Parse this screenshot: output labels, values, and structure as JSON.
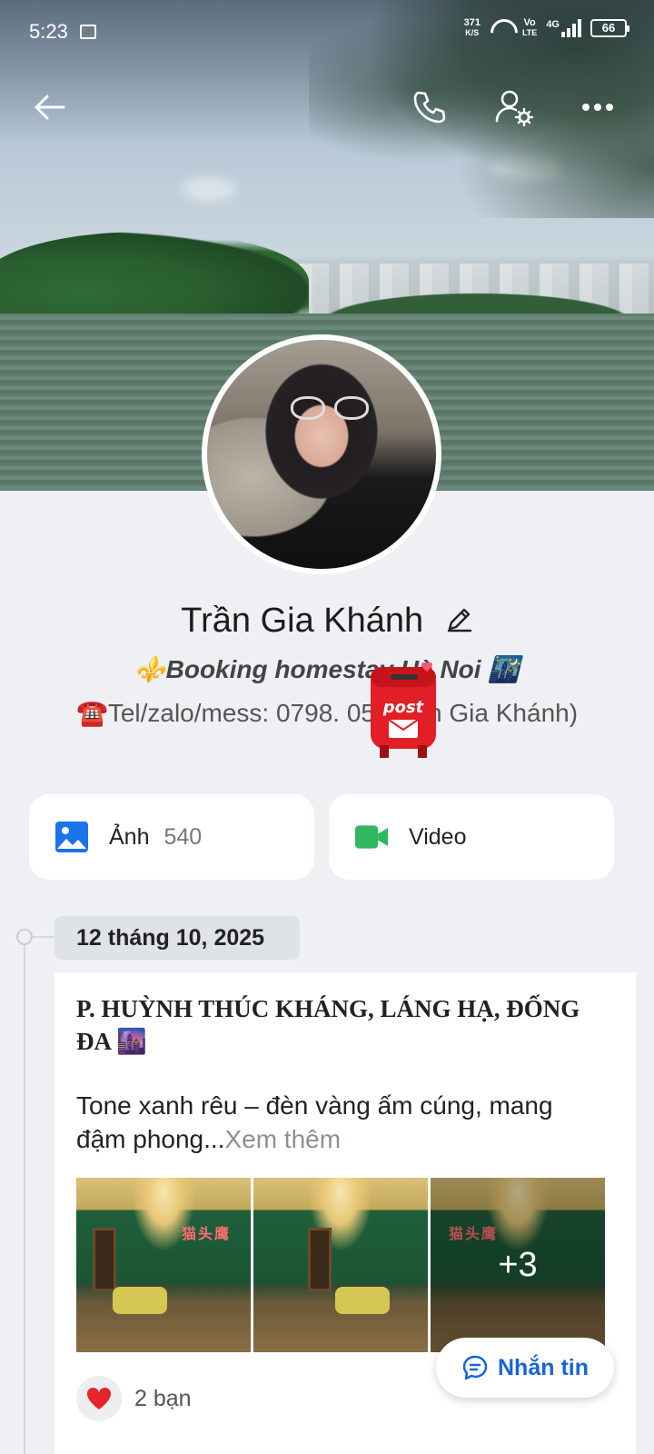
{
  "status_bar": {
    "time": "5:23",
    "net_speed_value": "371",
    "net_speed_unit": "K/S",
    "volte_top": "Vo",
    "volte_bottom": "LTE",
    "network": "4G",
    "battery": "66"
  },
  "profile": {
    "name": "Trần Gia Khánh",
    "bio_line1": "⚜️Booking homestay Hà Noi 🌃",
    "bio_line2": "☎️Tel/zalo/mess: 0798.   05 (Trần Gia Khánh)"
  },
  "media": {
    "photos_label": "Ảnh",
    "photos_count": "540",
    "video_label": "Video"
  },
  "feed": {
    "date": "12 tháng 10, 2025",
    "post": {
      "title": "P. HUỲNH THÚC KHÁNG, LÁNG HẠ, ĐỐNG ĐA 🌆",
      "text": "Tone xanh rêu – đèn vàng ấm cúng, mang đậm phong...",
      "see_more": "Xem thêm",
      "extra_photos": "+3",
      "neon_sign": "猫头鹰",
      "reactions": "2 bạn"
    }
  },
  "actions": {
    "message_label": "Nhắn tin"
  },
  "sticker_text": "post",
  "colors": {
    "accent": "#1565d8",
    "photo_icon": "#1a73e8",
    "video_icon": "#2fb85f",
    "heart": "#e5252a",
    "background": "#eef0f3"
  }
}
